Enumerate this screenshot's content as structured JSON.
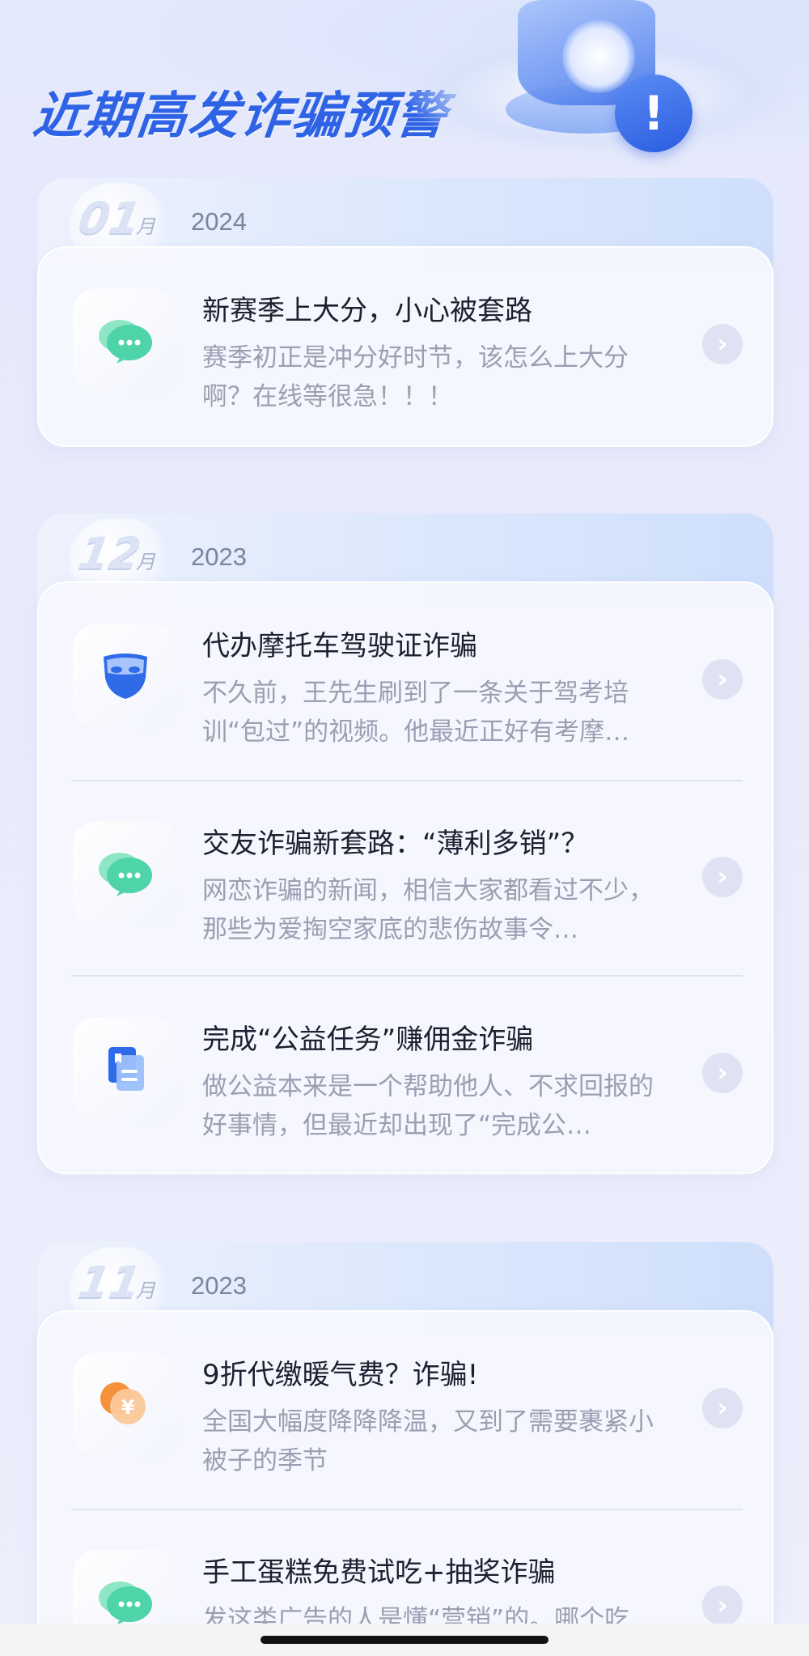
{
  "header": {
    "title": "近期高发诈骗预警"
  },
  "sections": [
    {
      "month": "01",
      "month_unit": "月",
      "year": "2024",
      "items": [
        {
          "icon": "chat-bubble-icon",
          "title": "新赛季上大分，小心被套路",
          "description": "赛季初正是冲分好时节，该怎么上大分啊？在线等很急！！！"
        }
      ]
    },
    {
      "month": "12",
      "month_unit": "月",
      "year": "2023",
      "items": [
        {
          "icon": "mask-icon",
          "title": "代办摩托车驾驶证诈骗",
          "description": "不久前，王先生刷到了一条关于驾考培训“包过”的视频。他最近正好有考摩…"
        },
        {
          "icon": "chat-bubble-icon",
          "title": "交友诈骗新套路：“薄利多销”？",
          "description": "网恋诈骗的新闻，相信大家都看过不少，那些为爱掏空家底的悲伤故事令…"
        },
        {
          "icon": "document-icon",
          "title": "完成“公益任务”赚佣金诈骗",
          "description": "做公益本来是一个帮助他人、不求回报的好事情，但最近却出现了“完成公…"
        }
      ]
    },
    {
      "month": "11",
      "month_unit": "月",
      "year": "2023",
      "items": [
        {
          "icon": "coin-icon",
          "title": "9折代缴暖气费？诈骗!",
          "description": "全国大幅度降降降温，又到了需要裹紧小被子的季节"
        },
        {
          "icon": "chat-bubble-icon",
          "title": "手工蛋糕免费试吃+抽奖诈骗",
          "description": "发这类广告的人是懂“营销”的。哪个吃"
        }
      ]
    }
  ],
  "colors": {
    "title_blue": "#2f63e6",
    "desc_gray": "#9a9fb2",
    "chat_green": "#4fd3a8",
    "mask_blue": "#2f6be8",
    "coin_orange": "#f5913a"
  }
}
